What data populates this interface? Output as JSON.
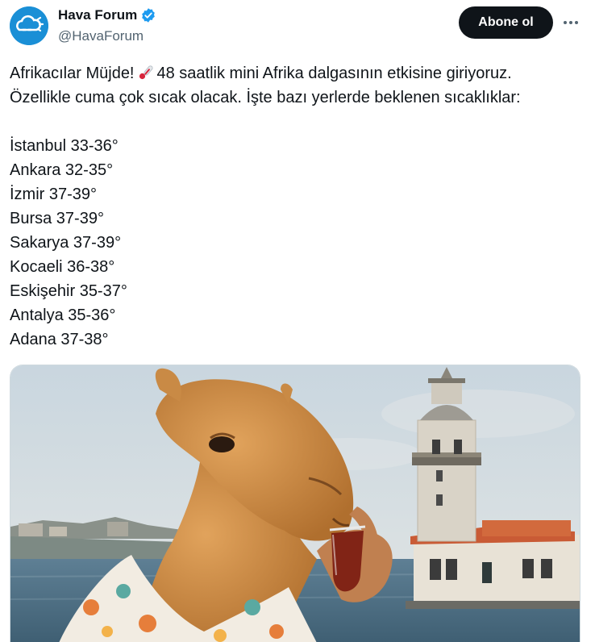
{
  "author": {
    "display_name": "Hava Forum",
    "handle": "@HavaForum",
    "verified": true,
    "avatar_icon": "cloud-sun-logo-icon",
    "avatar_color": "#1a8fd6"
  },
  "actions": {
    "follow_label": "Abone ol",
    "more_icon": "more-horizontal-icon"
  },
  "tweet": {
    "line1_part1": "Afrikacılar Müjde!",
    "line1_emoji": "thermometer-emoji",
    "line1_part2": "48 saatlik mini Afrika dalgasının etkisine giriyoruz.",
    "line2": "Özellikle cuma çok sıcak olacak. İşte bazı yerlerde beklenen sıcaklıklar:",
    "cities": [
      "İstanbul 33-36°",
      "Ankara 32-35°",
      "İzmir 37-39°",
      "Bursa 37-39°",
      "Sakarya 37-39°",
      "Kocaeli 36-38°",
      "Eskişehir 35-37°",
      "Antalya 35-36°",
      "Adana 37-38°"
    ]
  },
  "media": {
    "kind": "image",
    "subject": "camel-drinking-tea-maidens-tower-image"
  },
  "colors": {
    "text_primary": "#0f1419",
    "text_secondary": "#536471",
    "verified_blue": "#1d9bf0",
    "button_bg": "#0f1419"
  }
}
